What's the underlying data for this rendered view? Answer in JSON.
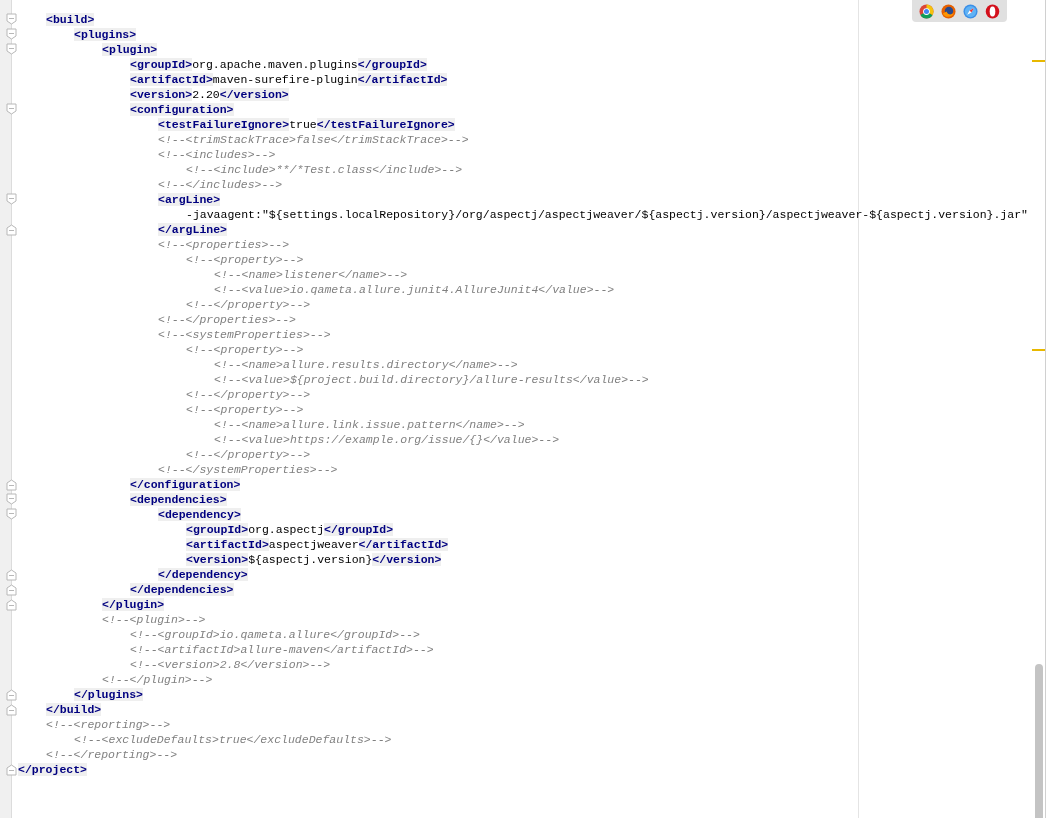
{
  "editor": {
    "lines": [
      {
        "fold_start": true,
        "segments": [
          {
            "kind": "tag",
            "text": "<build>"
          }
        ],
        "children": [
          {
            "fold_start": true,
            "segments": [
              {
                "kind": "tag",
                "text": "<plugins>"
              }
            ],
            "children": [
              {
                "fold_start": true,
                "segments": [
                  {
                    "kind": "tag",
                    "text": "<plugin>"
                  }
                ],
                "children": [
                  {
                    "segments": [
                      {
                        "kind": "tag",
                        "text": "<groupId>"
                      },
                      {
                        "kind": "text",
                        "text": "org.apache.maven.plugins"
                      },
                      {
                        "kind": "tag",
                        "text": "</groupId>"
                      }
                    ]
                  },
                  {
                    "segments": [
                      {
                        "kind": "tag",
                        "text": "<artifactId>"
                      },
                      {
                        "kind": "text",
                        "text": "maven-surefire-plugin"
                      },
                      {
                        "kind": "tag",
                        "text": "</artifactId>"
                      }
                    ]
                  },
                  {
                    "segments": [
                      {
                        "kind": "tag",
                        "text": "<version>"
                      },
                      {
                        "kind": "text",
                        "text": "2.20"
                      },
                      {
                        "kind": "tag",
                        "text": "</version>"
                      }
                    ]
                  },
                  {
                    "fold_start": true,
                    "segments": [
                      {
                        "kind": "tag",
                        "text": "<configuration>"
                      }
                    ],
                    "children": [
                      {
                        "segments": [
                          {
                            "kind": "tag",
                            "text": "<testFailureIgnore>"
                          },
                          {
                            "kind": "text",
                            "text": "true"
                          },
                          {
                            "kind": "tag",
                            "text": "</testFailureIgnore>"
                          }
                        ]
                      },
                      {
                        "segments": [
                          {
                            "kind": "comment",
                            "text": "<!--<trimStackTrace>false</trimStackTrace>-->"
                          }
                        ]
                      },
                      {
                        "segments": [
                          {
                            "kind": "comment",
                            "text": "<!--<includes>-->"
                          }
                        ],
                        "children": [
                          {
                            "segments": [
                              {
                                "kind": "comment",
                                "text": "<!--<include>**/*Test.class</include>-->"
                              }
                            ]
                          }
                        ]
                      },
                      {
                        "segments": [
                          {
                            "kind": "comment",
                            "text": "<!--</includes>-->"
                          }
                        ]
                      },
                      {
                        "fold_start": true,
                        "segments": [
                          {
                            "kind": "tag",
                            "text": "<argLine>"
                          }
                        ],
                        "children": [
                          {
                            "segments": [
                              {
                                "kind": "text",
                                "text": "-javaagent:\"${settings.localRepository}/org/aspectj/aspectjweaver/${aspectj.version}/aspectjweaver-${aspectj.version}.jar\""
                              }
                            ]
                          }
                        ]
                      },
                      {
                        "fold_end": true,
                        "segments": [
                          {
                            "kind": "tag",
                            "text": "</argLine>"
                          }
                        ]
                      },
                      {
                        "segments": [
                          {
                            "kind": "comment",
                            "text": "<!--<properties>-->"
                          }
                        ],
                        "children": [
                          {
                            "segments": [
                              {
                                "kind": "comment",
                                "text": "<!--<property>-->"
                              }
                            ],
                            "children": [
                              {
                                "segments": [
                                  {
                                    "kind": "comment",
                                    "text": "<!--<name>listener</name>-->"
                                  }
                                ]
                              },
                              {
                                "segments": [
                                  {
                                    "kind": "comment",
                                    "text": "<!--<value>io.qameta.allure.junit4.AllureJunit4</value>-->"
                                  }
                                ]
                              }
                            ]
                          },
                          {
                            "segments": [
                              {
                                "kind": "comment",
                                "text": "<!--</property>-->"
                              }
                            ]
                          }
                        ]
                      },
                      {
                        "segments": [
                          {
                            "kind": "comment",
                            "text": "<!--</properties>-->"
                          }
                        ]
                      },
                      {
                        "segments": [
                          {
                            "kind": "comment",
                            "text": "<!--<systemProperties>-->"
                          }
                        ],
                        "children": [
                          {
                            "segments": [
                              {
                                "kind": "comment",
                                "text": "<!--<property>-->"
                              }
                            ],
                            "children": [
                              {
                                "segments": [
                                  {
                                    "kind": "comment",
                                    "text": "<!--<name>allure.results.directory</name>-->"
                                  }
                                ]
                              },
                              {
                                "segments": [
                                  {
                                    "kind": "comment",
                                    "text": "<!--<value>${project.build.directory}/allure-results</value>-->"
                                  }
                                ]
                              }
                            ]
                          },
                          {
                            "segments": [
                              {
                                "kind": "comment",
                                "text": "<!--</property>-->"
                              }
                            ]
                          },
                          {
                            "segments": [
                              {
                                "kind": "comment",
                                "text": "<!--<property>-->"
                              }
                            ],
                            "children": [
                              {
                                "segments": [
                                  {
                                    "kind": "comment",
                                    "text": "<!--<name>allure.link.issue.pattern</name>-->"
                                  }
                                ]
                              },
                              {
                                "segments": [
                                  {
                                    "kind": "comment",
                                    "text": "<!--<value>https://example.org/issue/{}</value>-->"
                                  }
                                ]
                              }
                            ]
                          },
                          {
                            "segments": [
                              {
                                "kind": "comment",
                                "text": "<!--</property>-->"
                              }
                            ]
                          }
                        ]
                      },
                      {
                        "segments": [
                          {
                            "kind": "comment",
                            "text": "<!--</systemProperties>-->"
                          }
                        ]
                      }
                    ]
                  },
                  {
                    "fold_end": true,
                    "segments": [
                      {
                        "kind": "tag",
                        "text": "</configuration>"
                      }
                    ]
                  },
                  {
                    "fold_start": true,
                    "segments": [
                      {
                        "kind": "tag",
                        "text": "<dependencies>"
                      }
                    ],
                    "children": [
                      {
                        "fold_start": true,
                        "segments": [
                          {
                            "kind": "tag",
                            "text": "<dependency>"
                          }
                        ],
                        "children": [
                          {
                            "segments": [
                              {
                                "kind": "tag",
                                "text": "<groupId>"
                              },
                              {
                                "kind": "text",
                                "text": "org.aspectj"
                              },
                              {
                                "kind": "tag",
                                "text": "</groupId>"
                              }
                            ]
                          },
                          {
                            "segments": [
                              {
                                "kind": "tag",
                                "text": "<artifactId>"
                              },
                              {
                                "kind": "text",
                                "text": "aspectjweaver"
                              },
                              {
                                "kind": "tag",
                                "text": "</artifactId>"
                              }
                            ]
                          },
                          {
                            "segments": [
                              {
                                "kind": "tag",
                                "text": "<version>"
                              },
                              {
                                "kind": "text",
                                "text": "${aspectj.version}"
                              },
                              {
                                "kind": "tag",
                                "text": "</version>"
                              }
                            ]
                          }
                        ]
                      },
                      {
                        "fold_end": true,
                        "segments": [
                          {
                            "kind": "tag",
                            "text": "</dependency>"
                          }
                        ]
                      }
                    ]
                  },
                  {
                    "fold_end": true,
                    "segments": [
                      {
                        "kind": "tag",
                        "text": "</dependencies>"
                      }
                    ]
                  }
                ]
              },
              {
                "fold_end": true,
                "segments": [
                  {
                    "kind": "tag",
                    "text": "</plugin>"
                  }
                ]
              },
              {
                "segments": [
                  {
                    "kind": "comment",
                    "text": "<!--<plugin>-->"
                  }
                ],
                "children": [
                  {
                    "segments": [
                      {
                        "kind": "comment",
                        "text": "<!--<groupId>io.qameta.allure</groupId>-->"
                      }
                    ]
                  },
                  {
                    "segments": [
                      {
                        "kind": "comment",
                        "text": "<!--<artifactId>allure-maven</artifactId>-->"
                      }
                    ]
                  },
                  {
                    "segments": [
                      {
                        "kind": "comment",
                        "text": "<!--<version>2.8</version>-->"
                      }
                    ]
                  }
                ]
              },
              {
                "segments": [
                  {
                    "kind": "comment",
                    "text": "<!--</plugin>-->"
                  }
                ]
              }
            ]
          },
          {
            "fold_end": true,
            "segments": [
              {
                "kind": "tag",
                "text": "</plugins>"
              }
            ]
          }
        ]
      },
      {
        "fold_end": true,
        "segments": [
          {
            "kind": "tag",
            "text": "</build>"
          }
        ]
      },
      {
        "segments": [
          {
            "kind": "comment",
            "text": "<!--<reporting>-->"
          }
        ],
        "children": [
          {
            "segments": [
              {
                "kind": "comment",
                "text": "<!--<excludeDefaults>true</excludeDefaults>-->"
              }
            ]
          }
        ]
      },
      {
        "segments": [
          {
            "kind": "comment",
            "text": "<!--</reporting>-->"
          }
        ]
      }
    ],
    "closing_line": {
      "fold_end": true,
      "segments": [
        {
          "kind": "tag",
          "text": "</project>"
        }
      ]
    }
  }
}
